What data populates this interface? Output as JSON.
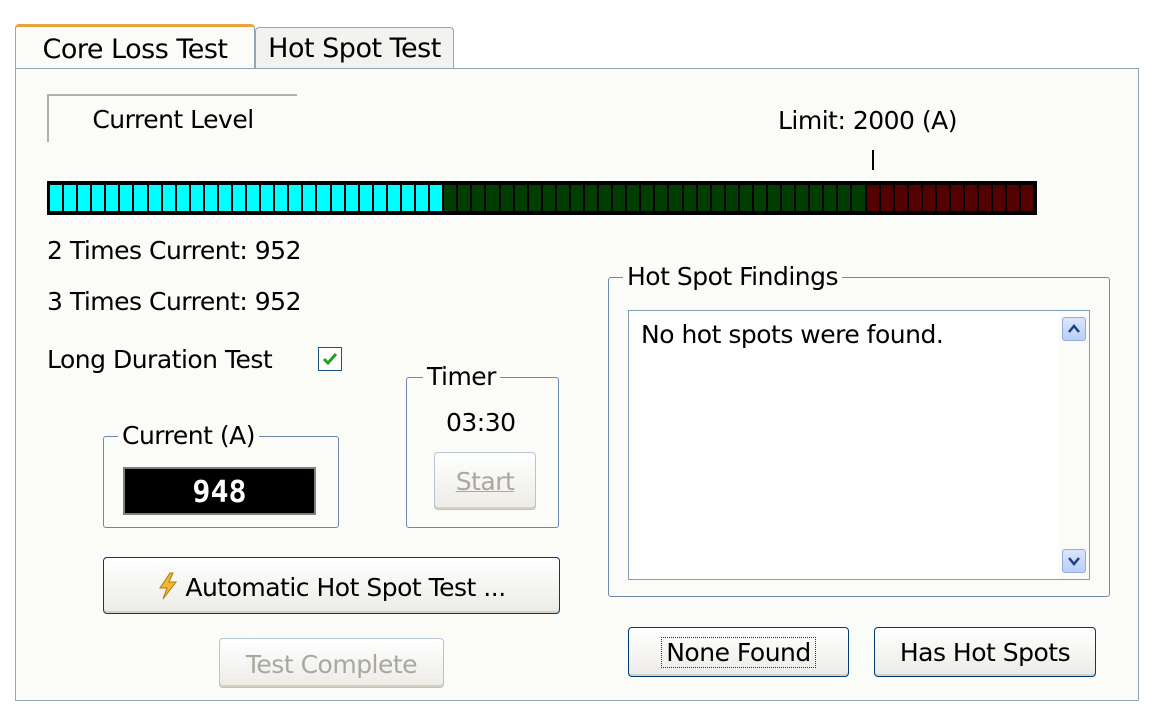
{
  "tabs": [
    {
      "label": "Core Loss Test",
      "active": true
    },
    {
      "label": "Hot Spot Test",
      "active": false
    }
  ],
  "level": {
    "label": "Current Level",
    "limit_text": "Limit: 2000 (A)",
    "meter": {
      "total_segments": 70,
      "lit_segments": 28,
      "limit_segment": 58,
      "colors": {
        "lit": "#00ffff",
        "unlit_normal": "#003d00",
        "unlit_over": "#520000"
      }
    }
  },
  "stats": {
    "two_times": "2 Times Current: 952",
    "three_times": "3 Times Current: 952"
  },
  "long_duration": {
    "label": "Long Duration Test",
    "checked": true
  },
  "current_group": {
    "legend": "Current (A)",
    "value": "948"
  },
  "timer_group": {
    "legend": "Timer",
    "time": "03:30",
    "start_label": "Start"
  },
  "buttons": {
    "automatic": "Automatic Hot Spot Test ...",
    "test_complete": "Test Complete",
    "none_found": "None Found",
    "has_hot_spots": "Has Hot Spots"
  },
  "findings": {
    "legend": "Hot Spot Findings",
    "text": "No hot spots were found."
  },
  "icons": {
    "automatic": "lightning-icon",
    "scroll_up": "chevron-up-icon",
    "scroll_down": "chevron-down-icon",
    "check": "checkmark-icon"
  },
  "colors": {
    "accent_tab": "#e8a33b",
    "group_border": "#6d88ad",
    "button_border": "#003c74"
  }
}
